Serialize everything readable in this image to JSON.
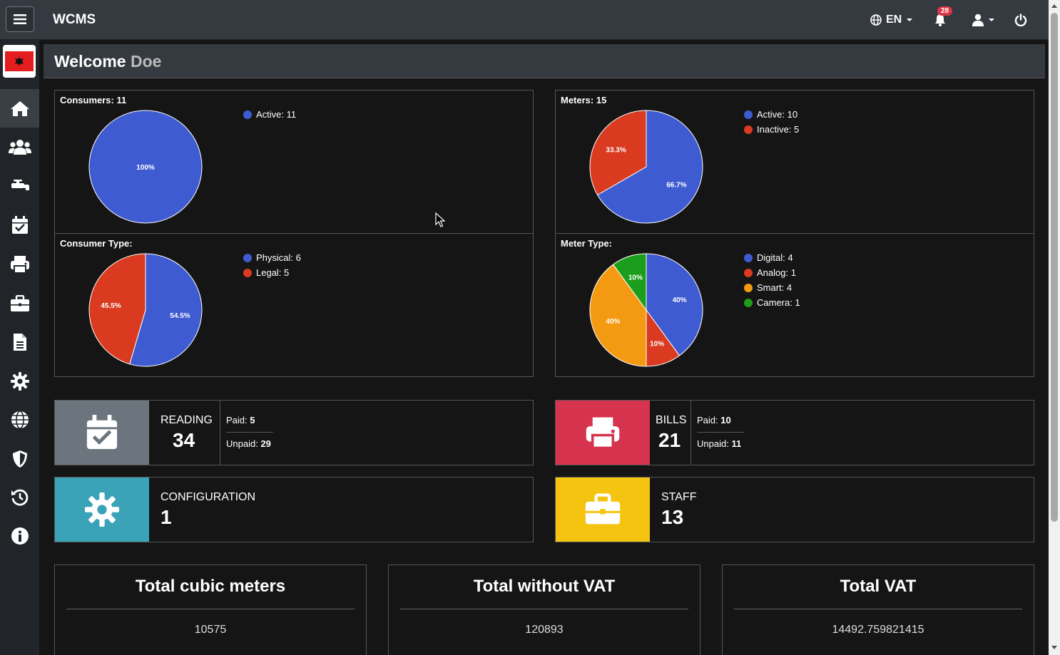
{
  "header": {
    "brand": "WCMS",
    "language": "EN",
    "notification_count": "28"
  },
  "welcome": {
    "greeting": "Welcome",
    "name": "Doe"
  },
  "charts": {
    "consumers": {
      "title": "Consumers: 11",
      "legend": [
        "Active: 11"
      ],
      "labels": [
        "100%"
      ]
    },
    "meters": {
      "title": "Meters: 15",
      "legend": [
        "Active: 10",
        "Inactive: 5"
      ],
      "labels": [
        "66.7%",
        "33.3%"
      ]
    },
    "consumer_type": {
      "title": "Consumer Type:",
      "legend": [
        "Physical: 6",
        "Legal: 5"
      ],
      "labels": [
        "54.5%",
        "45.5%"
      ]
    },
    "meter_type": {
      "title": "Meter Type:",
      "legend": [
        "Digital: 4",
        "Analog: 1",
        "Smart: 4",
        "Camera: 1"
      ],
      "labels": [
        "40%",
        "10%",
        "40%",
        "10%"
      ]
    }
  },
  "chart_data": [
    {
      "type": "pie",
      "title": "Consumers: 11",
      "categories": [
        "Active"
      ],
      "values": [
        11
      ],
      "colors": [
        "#3f5bd1"
      ]
    },
    {
      "type": "pie",
      "title": "Meters: 15",
      "categories": [
        "Active",
        "Inactive"
      ],
      "values": [
        10,
        5
      ],
      "colors": [
        "#3f5bd1",
        "#d93a20"
      ]
    },
    {
      "type": "pie",
      "title": "Consumer Type:",
      "categories": [
        "Physical",
        "Legal"
      ],
      "values": [
        6,
        5
      ],
      "colors": [
        "#3f5bd1",
        "#d93a20"
      ]
    },
    {
      "type": "pie",
      "title": "Meter Type:",
      "categories": [
        "Digital",
        "Analog",
        "Smart",
        "Camera"
      ],
      "values": [
        4,
        1,
        4,
        1
      ],
      "colors": [
        "#3f5bd1",
        "#d93a20",
        "#f39a12",
        "#1c9e1c"
      ]
    }
  ],
  "stats": {
    "reading": {
      "label": "READING",
      "value": "34",
      "paid_label": "Paid:",
      "paid": "5",
      "unpaid_label": "Unpaid:",
      "unpaid": "29"
    },
    "bills": {
      "label": "BILLS",
      "value": "21",
      "paid_label": "Paid:",
      "paid": "10",
      "unpaid_label": "Unpaid:",
      "unpaid": "11"
    },
    "configuration": {
      "label": "CONFIGURATION",
      "value": "1"
    },
    "staff": {
      "label": "STAFF",
      "value": "13"
    }
  },
  "totals": [
    {
      "title": "Total cubic meters",
      "value": "10575"
    },
    {
      "title": "Total without VAT",
      "value": "120893"
    },
    {
      "title": "Total VAT",
      "value": "14492.759821415"
    }
  ],
  "colors": {
    "reading": "#6c757d",
    "bills": "#d6334e",
    "configuration": "#3aa3b8",
    "staff": "#f5c410"
  },
  "sidebar_icons": [
    "home-icon",
    "users-icon",
    "faucet-icon",
    "calendar-check-icon",
    "print-icon",
    "briefcase-icon",
    "file-icon",
    "gear-icon",
    "globe-icon",
    "shield-icon",
    "history-icon",
    "info-icon"
  ]
}
